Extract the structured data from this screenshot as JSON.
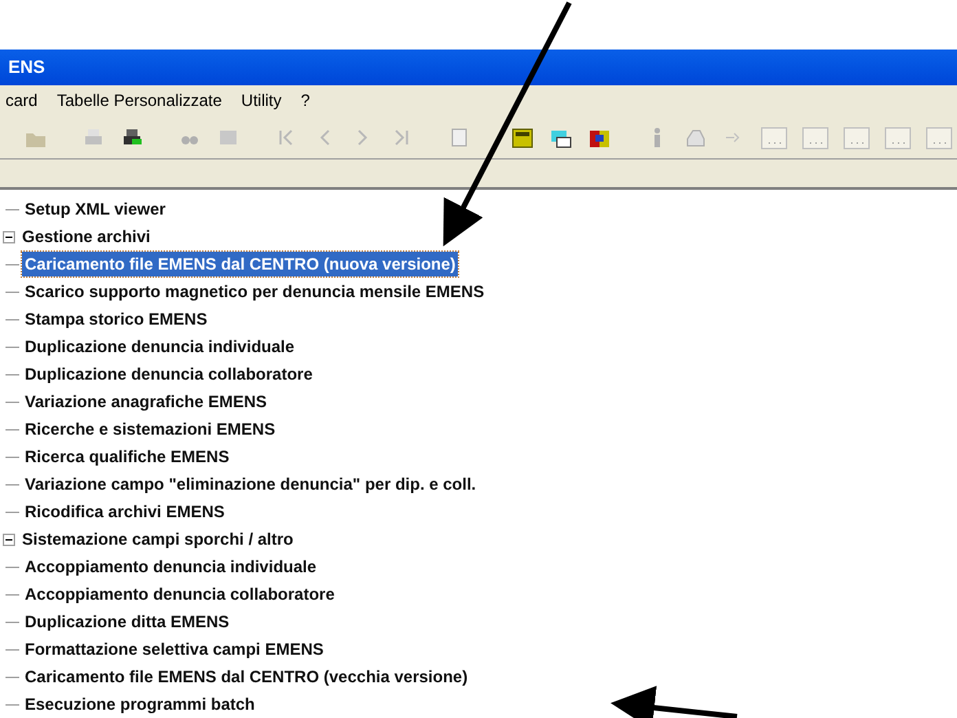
{
  "window": {
    "title": "ENS"
  },
  "menu": [
    {
      "label": "card"
    },
    {
      "label": "Tabelle Personalizzate"
    },
    {
      "label": "Utility"
    },
    {
      "label": "?"
    }
  ],
  "tree": [
    {
      "label": "Setup XML viewer",
      "kind": "leaf",
      "selected": false
    },
    {
      "label": "Gestione archivi",
      "kind": "branch",
      "expanded": true,
      "selected": false
    },
    {
      "label": "Caricamento file EMENS dal CENTRO (nuova versione)",
      "kind": "leaf",
      "selected": true
    },
    {
      "label": "Scarico supporto magnetico per denuncia mensile EMENS",
      "kind": "leaf",
      "selected": false
    },
    {
      "label": "Stampa storico EMENS",
      "kind": "leaf",
      "selected": false
    },
    {
      "label": "Duplicazione denuncia individuale",
      "kind": "leaf",
      "selected": false
    },
    {
      "label": "Duplicazione denuncia collaboratore",
      "kind": "leaf",
      "selected": false
    },
    {
      "label": "Variazione anagrafiche EMENS",
      "kind": "leaf",
      "selected": false
    },
    {
      "label": "Ricerche e sistemazioni EMENS",
      "kind": "leaf",
      "selected": false
    },
    {
      "label": "Ricerca qualifiche EMENS",
      "kind": "leaf",
      "selected": false
    },
    {
      "label": "Variazione campo \"eliminazione denuncia\" per dip. e coll.",
      "kind": "leaf",
      "selected": false
    },
    {
      "label": "Ricodifica archivi EMENS",
      "kind": "leaf",
      "selected": false
    },
    {
      "label": "Sistemazione campi sporchi / altro",
      "kind": "branch",
      "expanded": true,
      "selected": false
    },
    {
      "label": "Accoppiamento denuncia individuale",
      "kind": "leaf",
      "selected": false
    },
    {
      "label": "Accoppiamento denuncia collaboratore",
      "kind": "leaf",
      "selected": false
    },
    {
      "label": "Duplicazione ditta EMENS",
      "kind": "leaf",
      "selected": false
    },
    {
      "label": "Formattazione selettiva campi EMENS",
      "kind": "leaf",
      "selected": false
    },
    {
      "label": "Caricamento file EMENS dal CENTRO (vecchia versione)",
      "kind": "leaf",
      "selected": false
    },
    {
      "label": "Esecuzione programmi batch",
      "kind": "leaf",
      "selected": false
    }
  ]
}
